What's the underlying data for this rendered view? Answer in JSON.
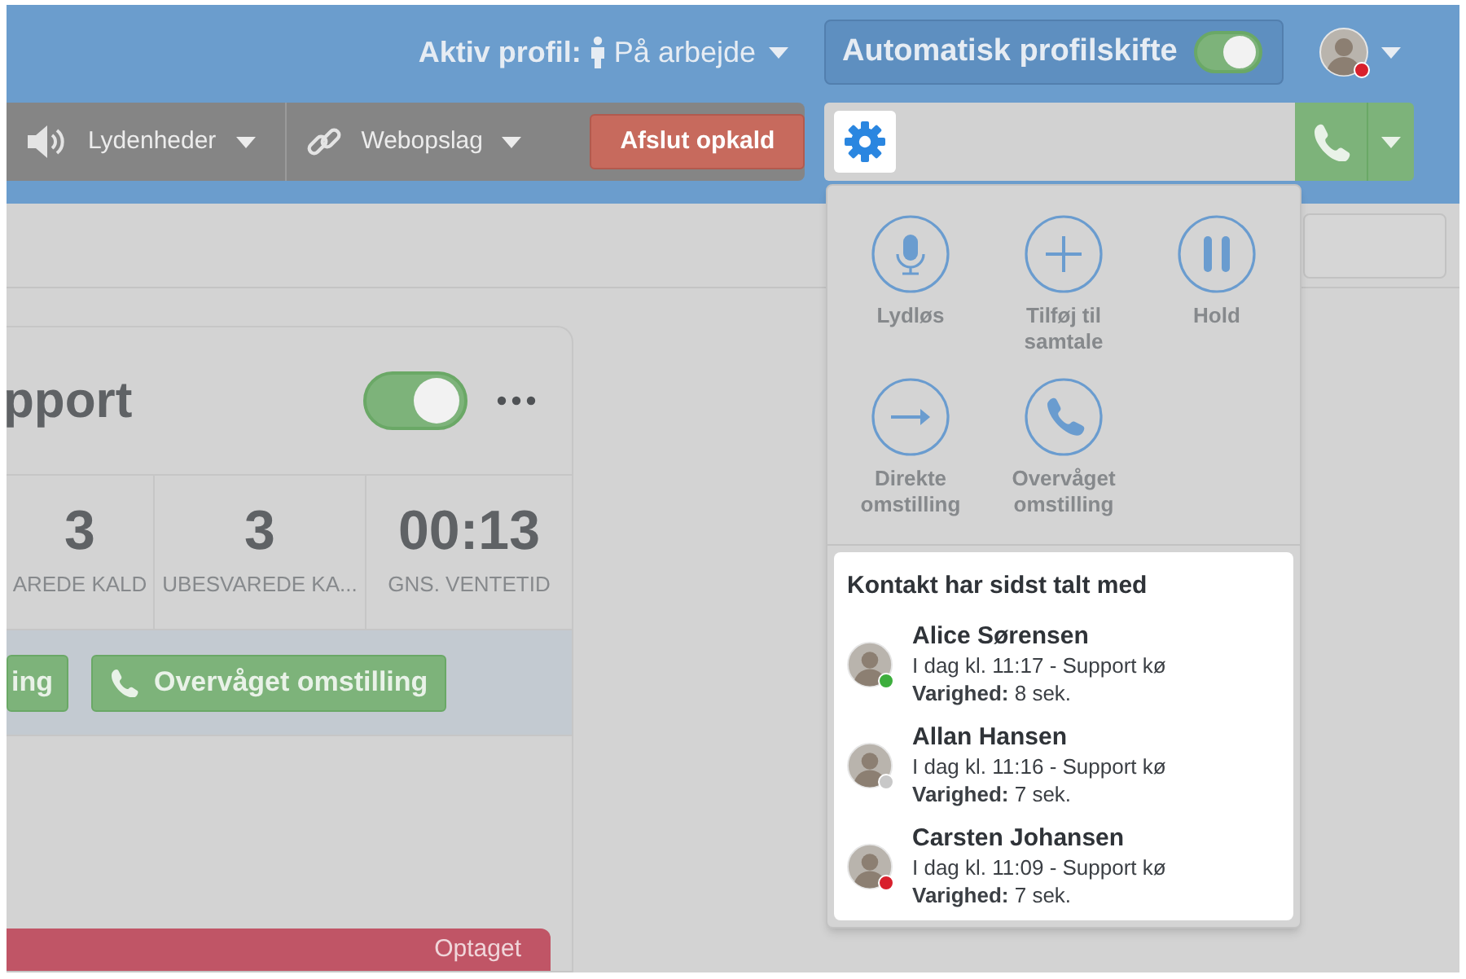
{
  "header": {
    "profile_label": "Aktiv profil:",
    "profile_value": "På arbejde",
    "auto_switch": {
      "label": "Automatisk profilskifte",
      "on": true
    },
    "user": {
      "color": "#d8202c"
    }
  },
  "toolbar": {
    "items": [
      {
        "kind": "sound",
        "label": "Lydenheder"
      },
      {
        "kind": "link",
        "label": "Webopslag"
      },
      {
        "kind": "danger",
        "label": "Afslut opkald"
      }
    ]
  },
  "queue_card": {
    "title": "pport",
    "on": true,
    "stats": [
      {
        "value": "3",
        "label": "AREDE KALD"
      },
      {
        "value": "3",
        "label": "UBESVAREDE KA..."
      },
      {
        "value": "00:13",
        "label": "GNS. VENTETID"
      }
    ],
    "actions": [
      {
        "kind": "plain",
        "label": "ing"
      },
      {
        "kind": "phone",
        "label": "Overvåget omstilling"
      }
    ]
  },
  "status_bar": {
    "label": "Optaget"
  },
  "call_menu": {
    "actions": [
      {
        "kind": "mic",
        "label": "Lydløs"
      },
      {
        "kind": "plus",
        "label": "Tilføj til samtale"
      },
      {
        "kind": "pause",
        "label": "Hold"
      },
      {
        "kind": "arrow",
        "label": "Direkte omstilling"
      },
      {
        "kind": "phone",
        "label": "Overvåget omstilling"
      }
    ],
    "recent": {
      "title": "Kontakt har sidst talt med",
      "contacts": [
        {
          "name": "Alice Sørensen",
          "detail": "I dag kl. 11:17 - Support kø",
          "duration": "**Varighed:** 8 sek.",
          "color": "#3dae3d"
        },
        {
          "name": "Allan Hansen",
          "detail": "I dag kl. 11:16 - Support kø",
          "duration": "**Varighed:** 7 sek.",
          "color": "#c8c8c8"
        },
        {
          "name": "Carsten Johansen",
          "detail": "I dag kl. 11:09 - Support kø",
          "duration": "**Varighed:** 7 sek.",
          "color": "#d8202c"
        }
      ]
    }
  }
}
